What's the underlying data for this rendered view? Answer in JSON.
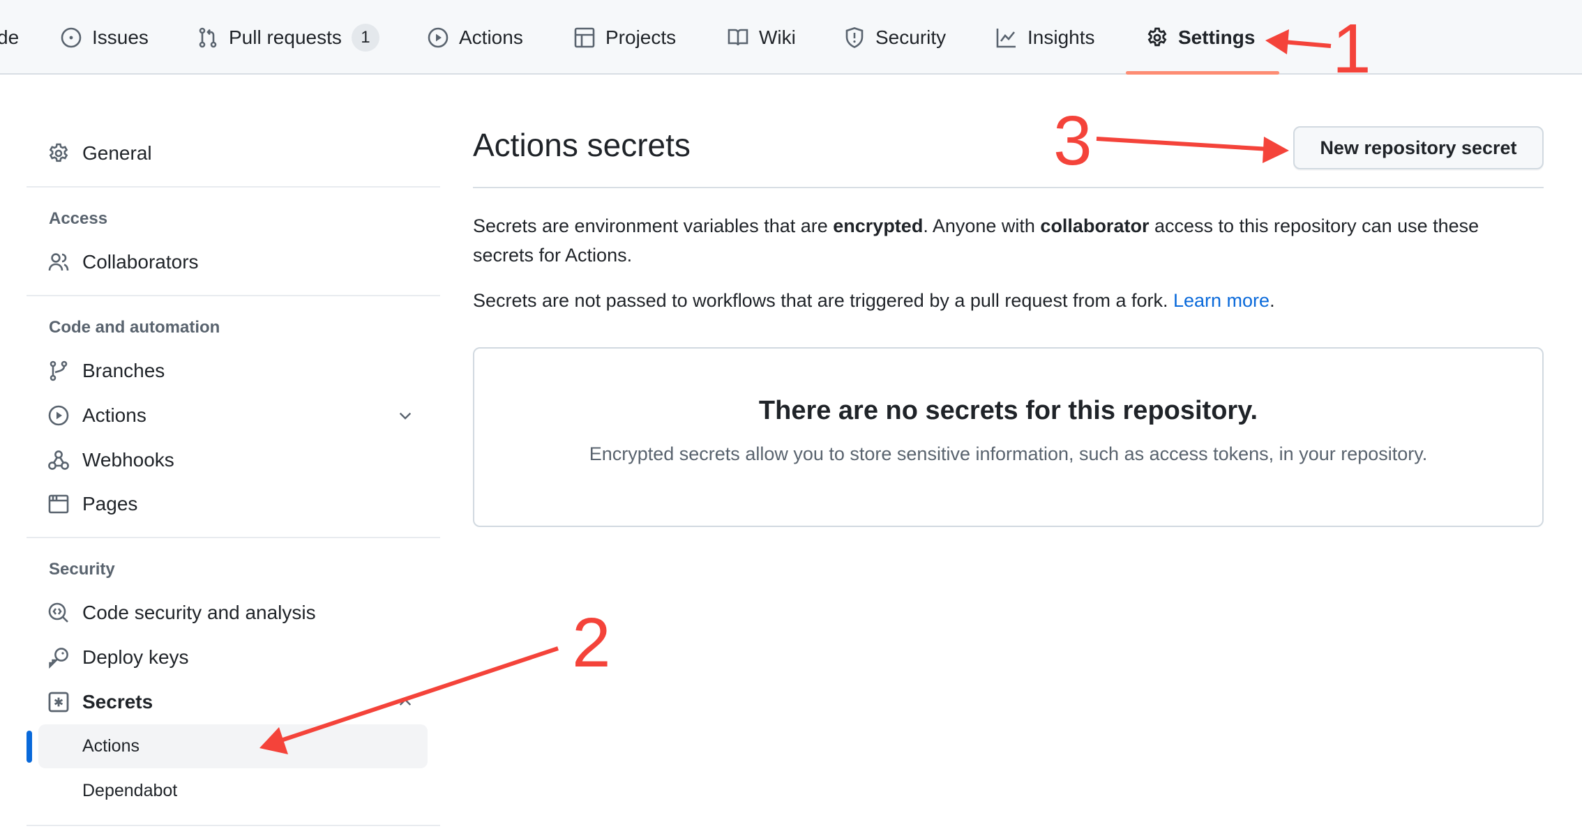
{
  "topnav": {
    "partial_tab_label": "de",
    "tabs": [
      {
        "label": "Issues",
        "icon": "issue-opened-icon"
      },
      {
        "label": "Pull requests",
        "icon": "git-pull-request-icon",
        "count": "1"
      },
      {
        "label": "Actions",
        "icon": "play-icon"
      },
      {
        "label": "Projects",
        "icon": "table-icon"
      },
      {
        "label": "Wiki",
        "icon": "book-icon"
      },
      {
        "label": "Security",
        "icon": "shield-icon"
      },
      {
        "label": "Insights",
        "icon": "graph-icon"
      },
      {
        "label": "Settings",
        "icon": "gear-icon",
        "selected": true
      }
    ],
    "selected_underline_color": "#fd8c73"
  },
  "sidebar": {
    "general": {
      "label": "General",
      "icon": "gear-icon"
    },
    "sections": [
      {
        "heading": "Access",
        "items": [
          {
            "label": "Collaborators",
            "icon": "people-icon"
          }
        ]
      },
      {
        "heading": "Code and automation",
        "items": [
          {
            "label": "Branches",
            "icon": "git-branch-icon"
          },
          {
            "label": "Actions",
            "icon": "play-icon",
            "expandable": true,
            "expanded": false
          },
          {
            "label": "Webhooks",
            "icon": "webhook-icon"
          },
          {
            "label": "Pages",
            "icon": "browser-icon"
          }
        ]
      },
      {
        "heading": "Security",
        "items": [
          {
            "label": "Code security and analysis",
            "icon": "codescan-icon"
          },
          {
            "label": "Deploy keys",
            "icon": "key-icon"
          },
          {
            "label": "Secrets",
            "icon": "key-asterisk-icon",
            "expandable": true,
            "expanded": true,
            "children": [
              {
                "label": "Actions",
                "active": true
              },
              {
                "label": "Dependabot",
                "active": false
              }
            ]
          }
        ]
      }
    ],
    "active_indicator_color": "#0969da"
  },
  "main": {
    "title": "Actions secrets",
    "new_button_label": "New repository secret",
    "description": {
      "p1_part1": "Secrets are environment variables that are ",
      "p1_bold1": "encrypted",
      "p1_part2": ". Anyone with ",
      "p1_bold2": "collaborator",
      "p1_part3": " access to this repository can use these secrets for Actions.",
      "p2_text": "Secrets are not passed to workflows that are triggered by a pull request from a fork. ",
      "p2_link": "Learn more",
      "p2_end": "."
    },
    "blankslate": {
      "heading": "There are no secrets for this repository.",
      "text": "Encrypted secrets allow you to store sensitive information, such as access tokens, in your repository."
    },
    "link_color": "#0969da"
  },
  "annotations": {
    "color": "#f4433a",
    "labels": [
      "1",
      "2",
      "3"
    ]
  }
}
